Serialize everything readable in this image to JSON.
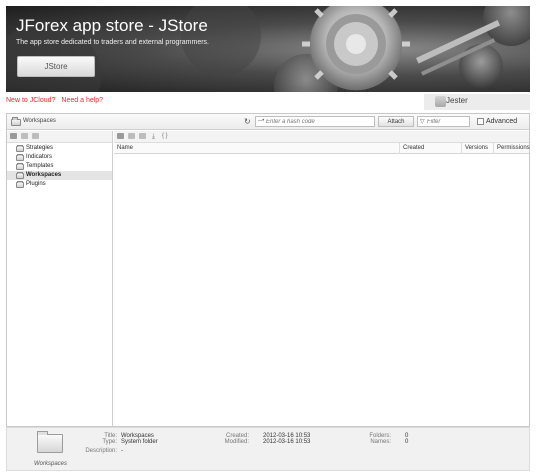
{
  "banner": {
    "title": "JForex app store - JStore",
    "subtitle": "The app store dedicated to traders and external programmers.",
    "button_label": "JStore"
  },
  "links": {
    "new_to_jcloud": "New to JCloud?",
    "need_help": "Need a help?"
  },
  "user": {
    "name": "Jester"
  },
  "toolbar": {
    "breadcrumb": "Workspaces",
    "hash_placeholder": "Enter a hash code",
    "attach_label": "Attach",
    "filter_placeholder": "Filter",
    "advanced_label": "Advanced"
  },
  "tree": {
    "items": [
      {
        "label": "Strategies",
        "selected": false
      },
      {
        "label": "Indicators",
        "selected": false
      },
      {
        "label": "Templates",
        "selected": false
      },
      {
        "label": "Workspaces",
        "selected": true
      },
      {
        "label": "Plugins",
        "selected": false
      }
    ]
  },
  "table": {
    "columns": [
      "Name",
      "Created",
      "Versions",
      "Permissions"
    ]
  },
  "details": {
    "caption": "Workspaces",
    "title_label": "Title:",
    "title_value": "Workspaces",
    "type_label": "Type:",
    "type_value": "System folder",
    "description_label": "Description:",
    "description_value": "-",
    "created_label": "Created:",
    "created_value": "2012-03-16 10:53",
    "modified_label": "Modified:",
    "modified_value": "2012-03-16 10:53",
    "folders_label": "Folders:",
    "folders_value": "0",
    "names_label": "Names:",
    "names_value": "0"
  },
  "icons": {
    "refresh": "refresh-icon",
    "key": "key-icon",
    "filter": "filter-icon",
    "folder": "folder-icon",
    "avatar": "avatar-icon"
  },
  "colors": {
    "link": "#d9303a",
    "selected_row": "#e4e4e4"
  }
}
